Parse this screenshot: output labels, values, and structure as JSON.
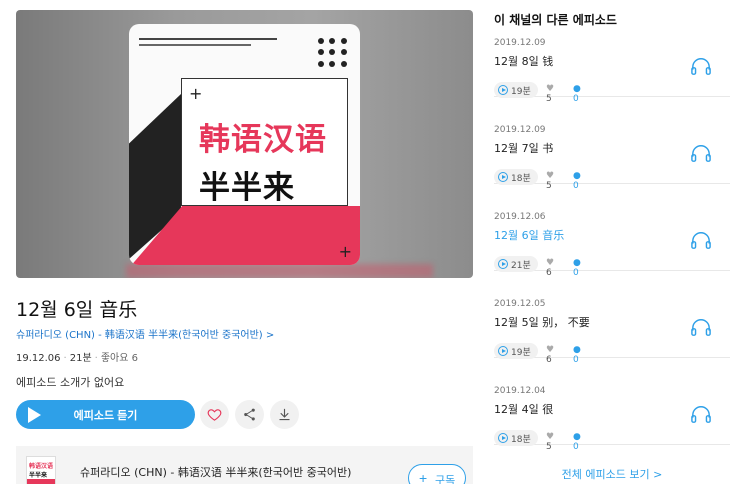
{
  "hero": {
    "title_line1": "韩语汉语",
    "title_line2": "半半来"
  },
  "episode": {
    "title": "12월 6일 音乐",
    "channel_link": "슈퍼라디오 (CHN) - 韩语汉语 半半来(한국어반 중국어반) >",
    "date": "19.12.06",
    "duration": "21분",
    "likes_label": "좋아요 6",
    "description": "에피소드 소개가 없어요",
    "listen_label": "에피소드 듣기"
  },
  "channel_bar": {
    "thumb_line1": "韩语汉语",
    "thumb_line2": "半半来",
    "name": "슈퍼라디오 (CHN) - 韩语汉语 半半来(한국어반 중국어반)",
    "subscribe_label": "구독"
  },
  "sidebar": {
    "title": "이 채널의 다른 에피소드",
    "items": [
      {
        "date": "2019.12.09",
        "title": "12월 8일 钱",
        "duration": "19분",
        "likes": "5",
        "comments": "0"
      },
      {
        "date": "2019.12.09",
        "title": "12월 7일 书",
        "duration": "18분",
        "likes": "5",
        "comments": "0"
      },
      {
        "date": "2019.12.06",
        "title": "12월 6일 音乐",
        "duration": "21분",
        "likes": "6",
        "comments": "0",
        "active": true
      },
      {
        "date": "2019.12.05",
        "title": "12월 5일 别， 不要",
        "duration": "19분",
        "likes": "6",
        "comments": "0"
      },
      {
        "date": "2019.12.04",
        "title": "12월 4일 很",
        "duration": "18분",
        "likes": "5",
        "comments": "0"
      }
    ],
    "all_episodes_label": "전체 에피소드 보기 >"
  },
  "colors": {
    "accent": "#2ea0e8",
    "brand_red": "#e6375a"
  }
}
